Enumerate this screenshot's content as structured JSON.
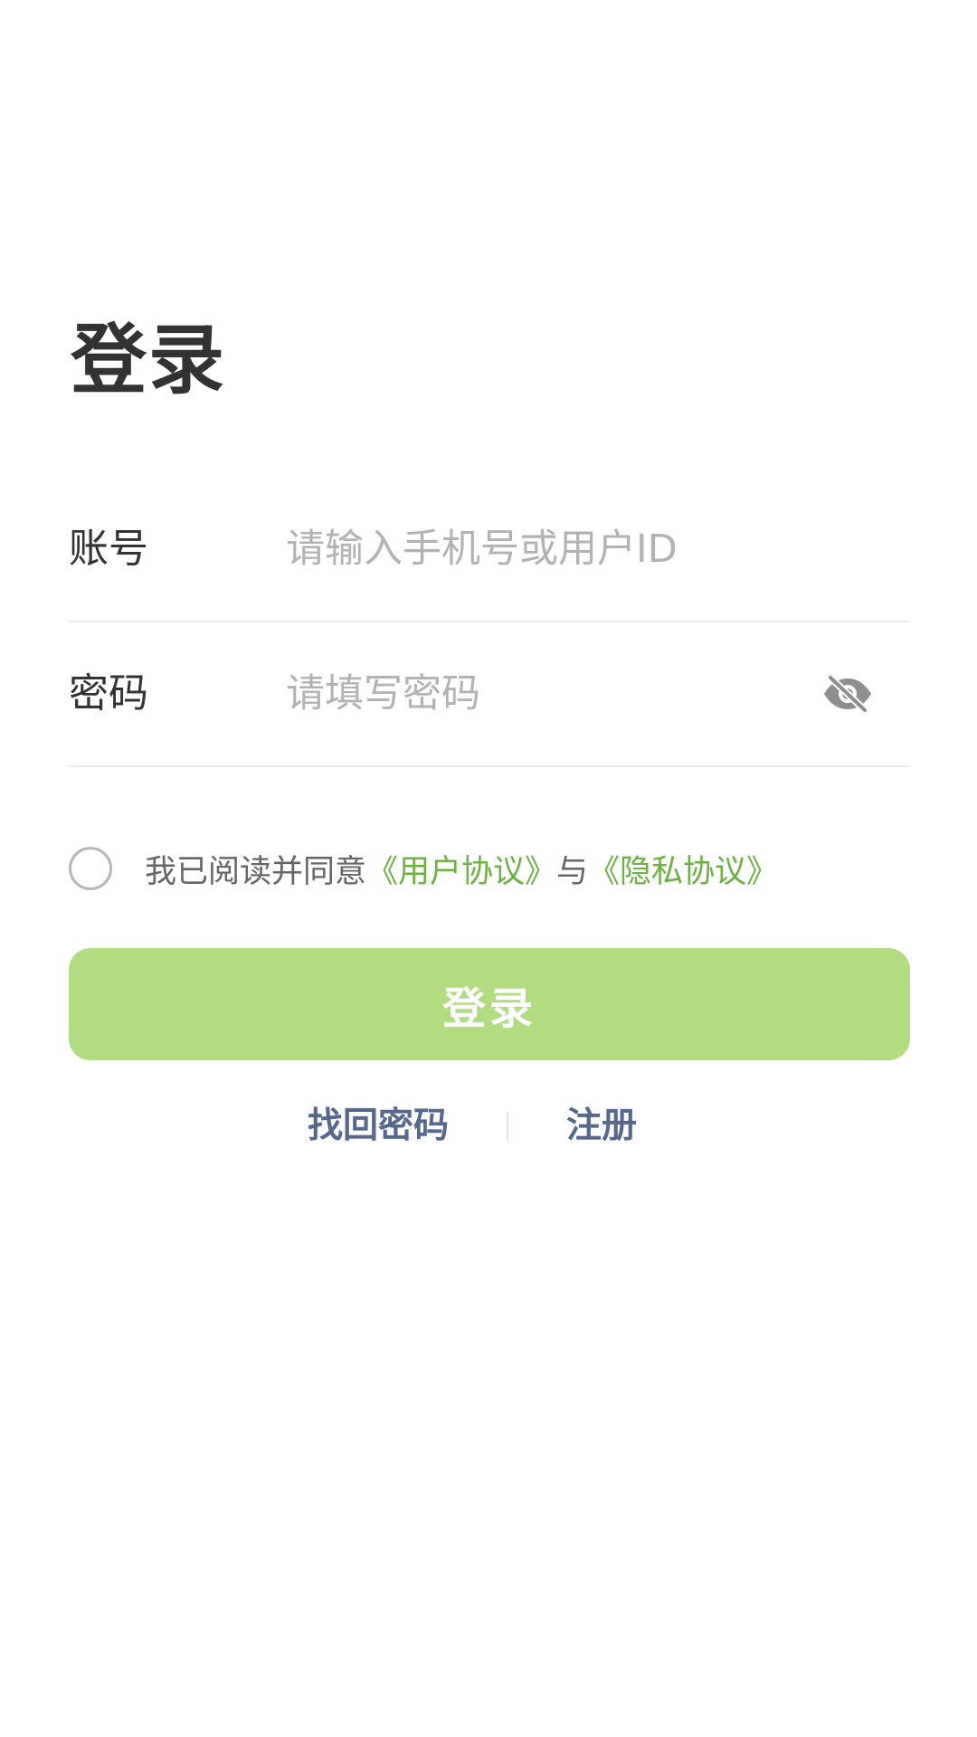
{
  "page": {
    "title": "登录"
  },
  "form": {
    "account": {
      "label": "账号",
      "placeholder": "请输入手机号或用户ID",
      "value": ""
    },
    "password": {
      "label": "密码",
      "placeholder": "请填写密码",
      "value": "",
      "visibility_icon": "eye-off-icon"
    }
  },
  "agreement": {
    "checked": false,
    "prefix": "我已阅读并同意",
    "user_agreement": "《用户协议》",
    "conjunction": "与",
    "privacy_policy": "《隐私协议》"
  },
  "login_button": {
    "label": "登录"
  },
  "links": {
    "forgot_password": "找回密码",
    "register": "注册"
  },
  "colors": {
    "accent": "#6cb33e",
    "button": "#b1dc80",
    "link": "#56688f"
  }
}
